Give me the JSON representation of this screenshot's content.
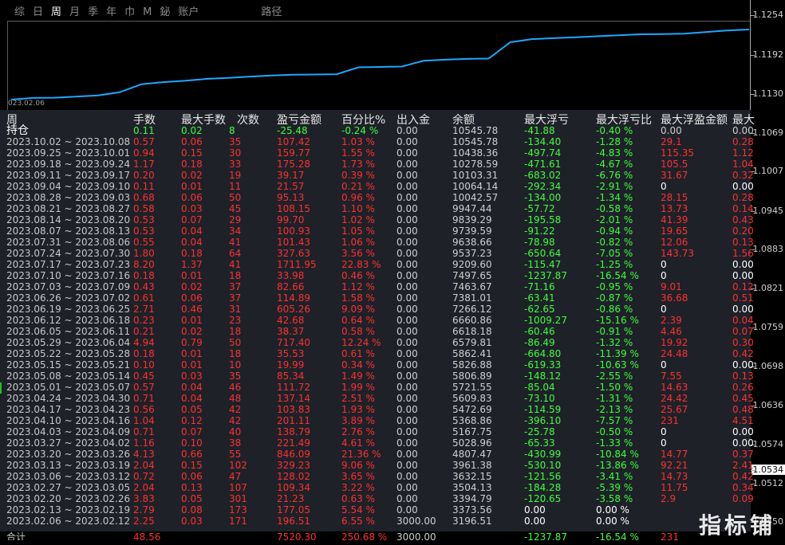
{
  "tabs": [
    "综",
    "日",
    "周",
    "月",
    "季",
    "年",
    "巾",
    "M",
    "鉍",
    "账户"
  ],
  "tab_extra": "路径",
  "active_tab": "周",
  "chart": {
    "start_date": "023.02.06",
    "line_color": "#1ea7ff",
    "equity_values": [
      3196.51,
      3373.56,
      3394.79,
      3504.13,
      3632.15,
      3961.38,
      4807.47,
      5028.96,
      5167.75,
      5368.86,
      5472.69,
      5609.83,
      5721.55,
      5806.89,
      5826.88,
      5862.41,
      6579.81,
      6618.18,
      6660.86,
      7266.12,
      7381.01,
      7463.67,
      7497.65,
      9209.6,
      9537.23,
      9638.66,
      9739.59,
      9839.29,
      9947.44,
      10042.57,
      10064.14,
      10103.31,
      10278.59,
      10438.36,
      10545.78
    ]
  },
  "price_axis": {
    "labels": [
      "1.1254",
      "1.1192",
      "1.1130",
      "1.1069",
      "1.1007",
      "1.0945",
      "1.0883",
      "1.0821",
      "1.0759",
      "1.0698",
      "1.0636",
      "1.0574",
      "1.0534",
      "1.0512",
      "1.0450"
    ],
    "current": "1.0534"
  },
  "headers": [
    "周",
    "手数",
    "最大手数",
    "次数",
    "盈亏金额",
    "百分比%",
    "出入金",
    "余额",
    "最大浮亏",
    "最大浮亏比",
    "最大浮盈金额",
    "最大"
  ],
  "hold_row": {
    "label": "持仓",
    "lots": "0.11",
    "max_lots": "0.02",
    "count": "8",
    "pnl": "-25.48",
    "pct": "-0.24 %",
    "inout": "0.00",
    "balance": "10545.78",
    "max_float_loss": "-41.88",
    "max_float_loss_pct": "-0.40 %",
    "max_float_profit": "0.00",
    "last": "0.00"
  },
  "rows": [
    {
      "label": "2023.10.02 ~ 2023.10.08",
      "lots": "0.57",
      "max_lots": "0.06",
      "count": "35",
      "pnl": "107.42",
      "pct": "1.03 %",
      "inout": "0.00",
      "balance": "10545.78",
      "max_float_loss": "-134.40",
      "max_float_loss_pct": "-1.28 %",
      "max_float_profit": "29.1",
      "last": "0.28"
    },
    {
      "label": "2023.09.25 ~ 2023.10.01",
      "lots": "0.94",
      "max_lots": "0.15",
      "count": "30",
      "pnl": "159.77",
      "pct": "1.55 %",
      "inout": "0.00",
      "balance": "10438.36",
      "max_float_loss": "-497.74",
      "max_float_loss_pct": "-4.83 %",
      "max_float_profit": "115.35",
      "last": "1.12"
    },
    {
      "label": "2023.09.18 ~ 2023.09.24",
      "lots": "1.17",
      "max_lots": "0.18",
      "count": "33",
      "pnl": "175.28",
      "pct": "1.73 %",
      "inout": "0.00",
      "balance": "10278.59",
      "max_float_loss": "-471.61",
      "max_float_loss_pct": "-4.67 %",
      "max_float_profit": "105.5",
      "last": "1.04"
    },
    {
      "label": "2023.09.11 ~ 2023.09.17",
      "lots": "0.20",
      "max_lots": "0.02",
      "count": "19",
      "pnl": "39.17",
      "pct": "0.39 %",
      "inout": "0.00",
      "balance": "10103.31",
      "max_float_loss": "-683.02",
      "max_float_loss_pct": "-6.76 %",
      "max_float_profit": "31.67",
      "last": "0.32"
    },
    {
      "label": "2023.09.04 ~ 2023.09.10",
      "lots": "0.11",
      "max_lots": "0.01",
      "count": "11",
      "pnl": "21.57",
      "pct": "0.21 %",
      "inout": "0.00",
      "balance": "10064.14",
      "max_float_loss": "-292.34",
      "max_float_loss_pct": "-2.91 %",
      "max_float_profit": "0",
      "last": "0.00"
    },
    {
      "label": "2023.08.28 ~ 2023.09.03",
      "lots": "0.68",
      "max_lots": "0.06",
      "count": "50",
      "pnl": "95.13",
      "pct": "0.96 %",
      "inout": "0.00",
      "balance": "10042.57",
      "max_float_loss": "-134.00",
      "max_float_loss_pct": "-1.34 %",
      "max_float_profit": "28.15",
      "last": "0.28"
    },
    {
      "label": "2023.08.21 ~ 2023.08.27",
      "lots": "0.58",
      "max_lots": "0.03",
      "count": "45",
      "pnl": "108.15",
      "pct": "1.10 %",
      "inout": "0.00",
      "balance": "9947.44",
      "max_float_loss": "-57.72",
      "max_float_loss_pct": "-0.58 %",
      "max_float_profit": "13.73",
      "last": "0.14"
    },
    {
      "label": "2023.08.14 ~ 2023.08.20",
      "lots": "0.53",
      "max_lots": "0.07",
      "count": "29",
      "pnl": "99.70",
      "pct": "1.02 %",
      "inout": "0.00",
      "balance": "9839.29",
      "max_float_loss": "-195.58",
      "max_float_loss_pct": "-2.01 %",
      "max_float_profit": "41.39",
      "last": "0.43"
    },
    {
      "label": "2023.08.07 ~ 2023.08.13",
      "lots": "0.53",
      "max_lots": "0.04",
      "count": "34",
      "pnl": "100.93",
      "pct": "1.05 %",
      "inout": "0.00",
      "balance": "9739.59",
      "max_float_loss": "-91.22",
      "max_float_loss_pct": "-0.94 %",
      "max_float_profit": "19.65",
      "last": "0.20"
    },
    {
      "label": "2023.07.31 ~ 2023.08.06",
      "lots": "0.55",
      "max_lots": "0.04",
      "count": "41",
      "pnl": "101.43",
      "pct": "1.06 %",
      "inout": "0.00",
      "balance": "9638.66",
      "max_float_loss": "-78.98",
      "max_float_loss_pct": "-0.82 %",
      "max_float_profit": "12.06",
      "last": "0.13"
    },
    {
      "label": "2023.07.24 ~ 2023.07.30",
      "lots": "1.80",
      "max_lots": "0.18",
      "count": "64",
      "pnl": "327.63",
      "pct": "3.56 %",
      "inout": "0.00",
      "balance": "9537.23",
      "max_float_loss": "-650.64",
      "max_float_loss_pct": "-7.05 %",
      "max_float_profit": "143.73",
      "last": "1.56"
    },
    {
      "label": "2023.07.17 ~ 2023.07.23",
      "lots": "8.20",
      "max_lots": "1.37",
      "count": "41",
      "pnl": "1711.95",
      "pct": "22.83 %",
      "inout": "0.00",
      "balance": "9209.60",
      "max_float_loss": "-115.47",
      "max_float_loss_pct": "-1.25 %",
      "max_float_profit": "0",
      "last": "0.00"
    },
    {
      "label": "2023.07.10 ~ 2023.07.16",
      "lots": "0.18",
      "max_lots": "0.01",
      "count": "18",
      "pnl": "33.98",
      "pct": "0.46 %",
      "inout": "0.00",
      "balance": "7497.65",
      "max_float_loss": "-1237.87",
      "max_float_loss_pct": "-16.54 %",
      "max_float_profit": "0",
      "last": "0.00"
    },
    {
      "label": "2023.07.03 ~ 2023.07.09",
      "lots": "0.43",
      "max_lots": "0.02",
      "count": "37",
      "pnl": "82.66",
      "pct": "1.12 %",
      "inout": "0.00",
      "balance": "7463.67",
      "max_float_loss": "-71.16",
      "max_float_loss_pct": "-0.95 %",
      "max_float_profit": "9.01",
      "last": "0.12"
    },
    {
      "label": "2023.06.26 ~ 2023.07.02",
      "lots": "0.61",
      "max_lots": "0.06",
      "count": "37",
      "pnl": "114.89",
      "pct": "1.58 %",
      "inout": "0.00",
      "balance": "7381.01",
      "max_float_loss": "-63.41",
      "max_float_loss_pct": "-0.87 %",
      "max_float_profit": "36.68",
      "last": "0.51"
    },
    {
      "label": "2023.06.19 ~ 2023.06.25",
      "lots": "2.71",
      "max_lots": "0.46",
      "count": "31",
      "pnl": "605.26",
      "pct": "9.09 %",
      "inout": "0.00",
      "balance": "7266.12",
      "max_float_loss": "-62.65",
      "max_float_loss_pct": "-0.86 %",
      "max_float_profit": "0",
      "last": "0.00"
    },
    {
      "label": "2023.06.12 ~ 2023.06.18",
      "lots": "0.23",
      "max_lots": "0.01",
      "count": "23",
      "pnl": "42.68",
      "pct": "0.64 %",
      "inout": "0.00",
      "balance": "6660.86",
      "max_float_loss": "-1009.27",
      "max_float_loss_pct": "-15.16 %",
      "max_float_profit": "2.39",
      "last": "0.04"
    },
    {
      "label": "2023.06.05 ~ 2023.06.11",
      "lots": "0.21",
      "max_lots": "0.02",
      "count": "18",
      "pnl": "38.37",
      "pct": "0.58 %",
      "inout": "0.00",
      "balance": "6618.18",
      "max_float_loss": "-60.46",
      "max_float_loss_pct": "-0.91 %",
      "max_float_profit": "4.46",
      "last": "0.07"
    },
    {
      "label": "2023.05.29 ~ 2023.06.04",
      "lots": "4.94",
      "max_lots": "0.79",
      "count": "50",
      "pnl": "717.40",
      "pct": "12.24 %",
      "inout": "0.00",
      "balance": "6579.81",
      "max_float_loss": "-86.49",
      "max_float_loss_pct": "-1.32 %",
      "max_float_profit": "19.92",
      "last": "0.30"
    },
    {
      "label": "2023.05.22 ~ 2023.05.28",
      "lots": "0.18",
      "max_lots": "0.01",
      "count": "18",
      "pnl": "35.53",
      "pct": "0.61 %",
      "inout": "0.00",
      "balance": "5862.41",
      "max_float_loss": "-664.80",
      "max_float_loss_pct": "-11.39 %",
      "max_float_profit": "24.48",
      "last": "0.42"
    },
    {
      "label": "2023.05.15 ~ 2023.05.21",
      "lots": "0.10",
      "max_lots": "0.01",
      "count": "10",
      "pnl": "19.99",
      "pct": "0.34 %",
      "inout": "0.00",
      "balance": "5826.88",
      "max_float_loss": "-619.33",
      "max_float_loss_pct": "-10.63 %",
      "max_float_profit": "0",
      "last": "0.00"
    },
    {
      "label": "2023.05.08 ~ 2023.05.14",
      "lots": "0.45",
      "max_lots": "0.03",
      "count": "35",
      "pnl": "85.34",
      "pct": "1.49 %",
      "inout": "0.00",
      "balance": "5806.89",
      "max_float_loss": "-148.12",
      "max_float_loss_pct": "-2.55 %",
      "max_float_profit": "7.55",
      "last": "0.13"
    },
    {
      "label": "2023.05.01 ~ 2023.05.07",
      "lots": "0.57",
      "max_lots": "0.04",
      "count": "46",
      "pnl": "111.72",
      "pct": "1.99 %",
      "inout": "0.00",
      "balance": "5721.55",
      "max_float_loss": "-85.04",
      "max_float_loss_pct": "-1.50 %",
      "max_float_profit": "14.63",
      "last": "0.26"
    },
    {
      "label": "2023.04.24 ~ 2023.04.30",
      "lots": "0.71",
      "max_lots": "0.04",
      "count": "48",
      "pnl": "137.14",
      "pct": "2.51 %",
      "inout": "0.00",
      "balance": "5609.83",
      "max_float_loss": "-73.10",
      "max_float_loss_pct": "-1.31 %",
      "max_float_profit": "24.42",
      "last": "0.45"
    },
    {
      "label": "2023.04.17 ~ 2023.04.23",
      "lots": "0.56",
      "max_lots": "0.05",
      "count": "42",
      "pnl": "103.83",
      "pct": "1.93 %",
      "inout": "0.00",
      "balance": "5472.69",
      "max_float_loss": "-114.59",
      "max_float_loss_pct": "-2.13 %",
      "max_float_profit": "25.67",
      "last": "0.48"
    },
    {
      "label": "2023.04.10 ~ 2023.04.16",
      "lots": "1.04",
      "max_lots": "0.12",
      "count": "42",
      "pnl": "201.11",
      "pct": "3.89 %",
      "inout": "0.00",
      "balance": "5368.86",
      "max_float_loss": "-396.10",
      "max_float_loss_pct": "-7.57 %",
      "max_float_profit": "231",
      "last": "4.51"
    },
    {
      "label": "2023.04.03 ~ 2023.04.09",
      "lots": "0.71",
      "max_lots": "0.07",
      "count": "40",
      "pnl": "138.79",
      "pct": "2.76 %",
      "inout": "0.00",
      "balance": "5167.75",
      "max_float_loss": "-25.78",
      "max_float_loss_pct": "-0.50 %",
      "max_float_profit": "0",
      "last": "0.00"
    },
    {
      "label": "2023.03.27 ~ 2023.04.02",
      "lots": "1.16",
      "max_lots": "0.10",
      "count": "38",
      "pnl": "221.49",
      "pct": "4.61 %",
      "inout": "0.00",
      "balance": "5028.96",
      "max_float_loss": "-65.33",
      "max_float_loss_pct": "-1.33 %",
      "max_float_profit": "0",
      "last": "0.00"
    },
    {
      "label": "2023.03.20 ~ 2023.03.26",
      "lots": "4.13",
      "max_lots": "0.66",
      "count": "55",
      "pnl": "846.09",
      "pct": "21.36 %",
      "inout": "0.00",
      "balance": "4807.47",
      "max_float_loss": "-430.99",
      "max_float_loss_pct": "-10.84 %",
      "max_float_profit": "14.77",
      "last": "0.37"
    },
    {
      "label": "2023.03.13 ~ 2023.03.19",
      "lots": "2.04",
      "max_lots": "0.15",
      "count": "102",
      "pnl": "329.23",
      "pct": "9.06 %",
      "inout": "0.00",
      "balance": "3961.38",
      "max_float_loss": "-530.10",
      "max_float_loss_pct": "-13.86 %",
      "max_float_profit": "92.21",
      "last": "2.41"
    },
    {
      "label": "2023.03.06 ~ 2023.03.12",
      "lots": "0.72",
      "max_lots": "0.06",
      "count": "47",
      "pnl": "128.02",
      "pct": "3.65 %",
      "inout": "0.00",
      "balance": "3632.15",
      "max_float_loss": "-121.56",
      "max_float_loss_pct": "-3.41 %",
      "max_float_profit": "14.73",
      "last": "0.42"
    },
    {
      "label": "2023.02.27 ~ 2023.03.05",
      "lots": "2.04",
      "max_lots": "0.13",
      "count": "107",
      "pnl": "109.34",
      "pct": "3.22 %",
      "inout": "0.00",
      "balance": "3504.13",
      "max_float_loss": "-184.28",
      "max_float_loss_pct": "-5.39 %",
      "max_float_profit": "11.75",
      "last": "0.34"
    },
    {
      "label": "2023.02.20 ~ 2023.02.26",
      "lots": "3.83",
      "max_lots": "0.05",
      "count": "301",
      "pnl": "21.23",
      "pct": "0.63 %",
      "inout": "0.00",
      "balance": "3394.79",
      "max_float_loss": "-120.65",
      "max_float_loss_pct": "-3.58 %",
      "max_float_profit": "2.9",
      "last": "0.09"
    },
    {
      "label": "2023.02.13 ~ 2023.02.19",
      "lots": "2.79",
      "max_lots": "0.08",
      "count": "173",
      "pnl": "177.05",
      "pct": "5.54 %",
      "inout": "0.00",
      "balance": "3373.56",
      "max_float_loss": "0.00",
      "max_float_loss_pct": "0.00 %",
      "max_float_profit": "",
      "last": ""
    },
    {
      "label": "2023.02.06 ~ 2023.02.12",
      "lots": "2.25",
      "max_lots": "0.03",
      "count": "171",
      "pnl": "196.51",
      "pct": "6.55 %",
      "inout": "3000.00",
      "balance": "3196.51",
      "max_float_loss": "0.00",
      "max_float_loss_pct": "0.00 %",
      "max_float_profit": "",
      "last": ""
    }
  ],
  "total_row": {
    "label": "合计",
    "lots": "48.56",
    "max_lots": "",
    "count": "",
    "pnl": "7520.30",
    "pct": "250.68 %",
    "inout": "3000.00",
    "balance": "",
    "max_float_loss": "-1237.87",
    "max_float_loss_pct": "-16.54 %",
    "max_float_profit": "231",
    "last": ""
  },
  "watermark": "指标铺"
}
